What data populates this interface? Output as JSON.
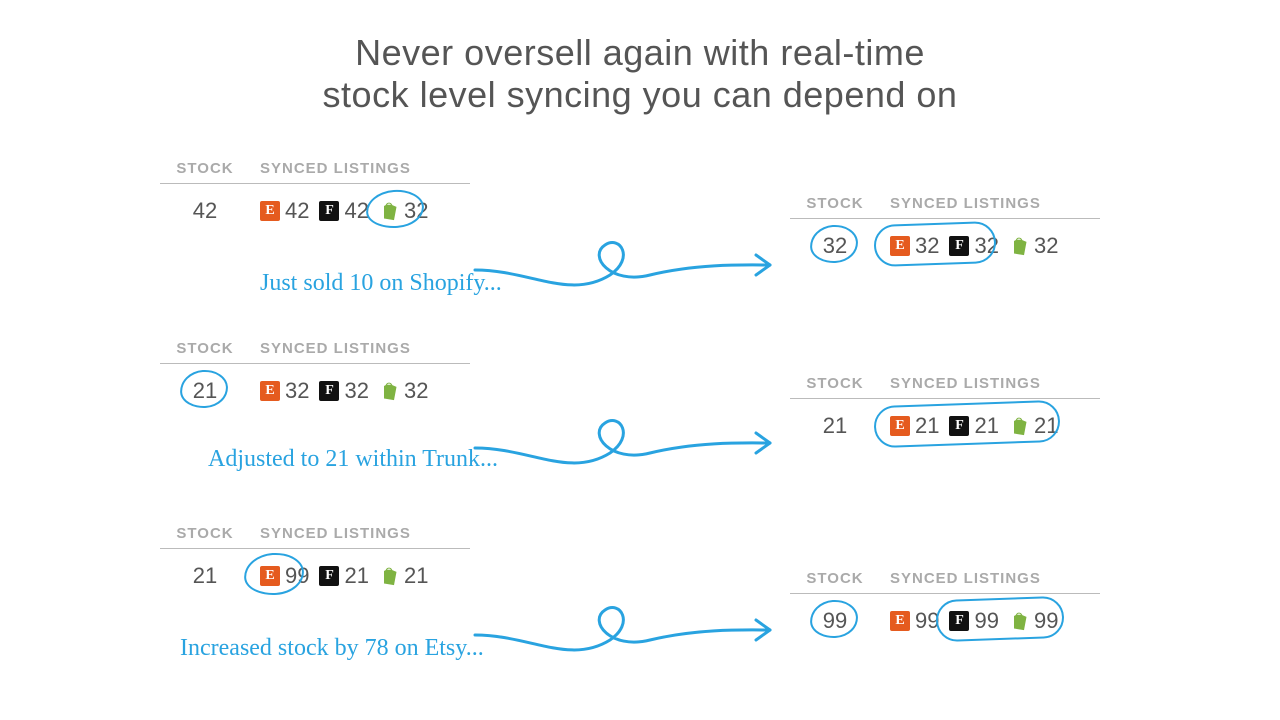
{
  "headline": {
    "line1": "Never oversell again with real-time",
    "line2": "stock level syncing you can depend on"
  },
  "headers": {
    "stock": "STOCK",
    "synced": "SYNCED LISTINGS"
  },
  "icons": {
    "etsy": "E",
    "faire": "F",
    "shopify": "shopify"
  },
  "rows": [
    {
      "before": {
        "stock": "42",
        "listings": {
          "etsy": "42",
          "faire": "42",
          "shopify": "32"
        }
      },
      "after": {
        "stock": "32",
        "listings": {
          "etsy": "32",
          "faire": "32",
          "shopify": "32"
        }
      },
      "note": "Just sold 10 on Shopify..."
    },
    {
      "before": {
        "stock": "21",
        "listings": {
          "etsy": "32",
          "faire": "32",
          "shopify": "32"
        }
      },
      "after": {
        "stock": "21",
        "listings": {
          "etsy": "21",
          "faire": "21",
          "shopify": "21"
        }
      },
      "note": "Adjusted to 21 within Trunk..."
    },
    {
      "before": {
        "stock": "21",
        "listings": {
          "etsy": "99",
          "faire": "21",
          "shopify": "21"
        }
      },
      "after": {
        "stock": "99",
        "listings": {
          "etsy": "99",
          "faire": "99",
          "shopify": "99"
        }
      },
      "note": "Increased stock by 78 on Etsy..."
    }
  ]
}
